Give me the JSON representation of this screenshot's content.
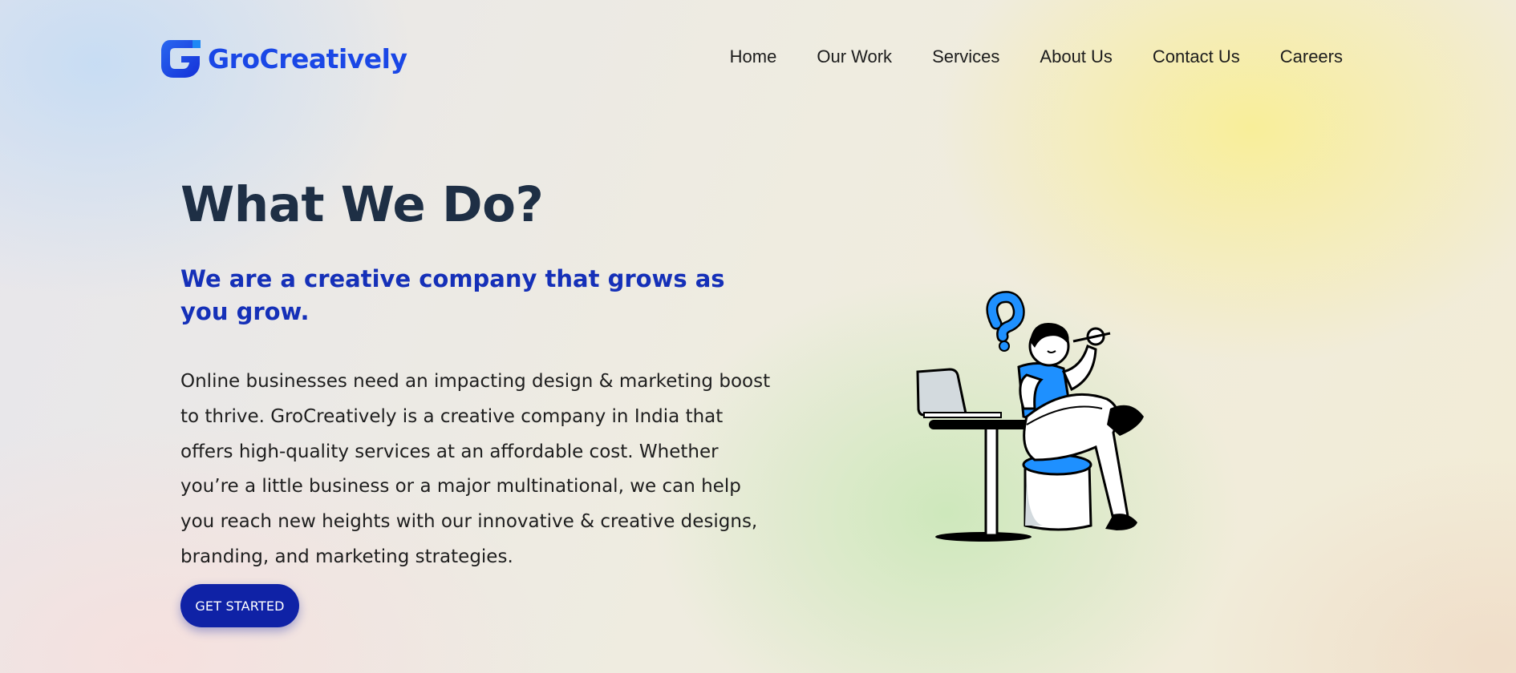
{
  "header": {
    "logo": {
      "text": "GroCreatively",
      "icon": "g-logo-icon",
      "color": "#1a47e6"
    },
    "nav": [
      {
        "label": "Home"
      },
      {
        "label": "Our Work"
      },
      {
        "label": "Services"
      },
      {
        "label": "About Us"
      },
      {
        "label": "Contact Us"
      },
      {
        "label": "Careers"
      }
    ]
  },
  "hero": {
    "title": "What We Do?",
    "subtitle": "We are a creative company that grows as you grow.",
    "description": "Online businesses need an impacting design & marketing boost to thrive. GroCreatively is a creative company in India that offers high-quality services at an affordable cost. Whether you’re a little business or a major multinational, we can help you reach new heights with our innovative & creative designs, branding, and marketing strategies.",
    "cta_label": "GET STARTED",
    "illustration": "person-thinking-at-laptop-illustration"
  },
  "colors": {
    "title": "#1e2f45",
    "subtitle": "#1530b8",
    "button": "#0f22a6",
    "accent_blue": "#1e90ff"
  }
}
